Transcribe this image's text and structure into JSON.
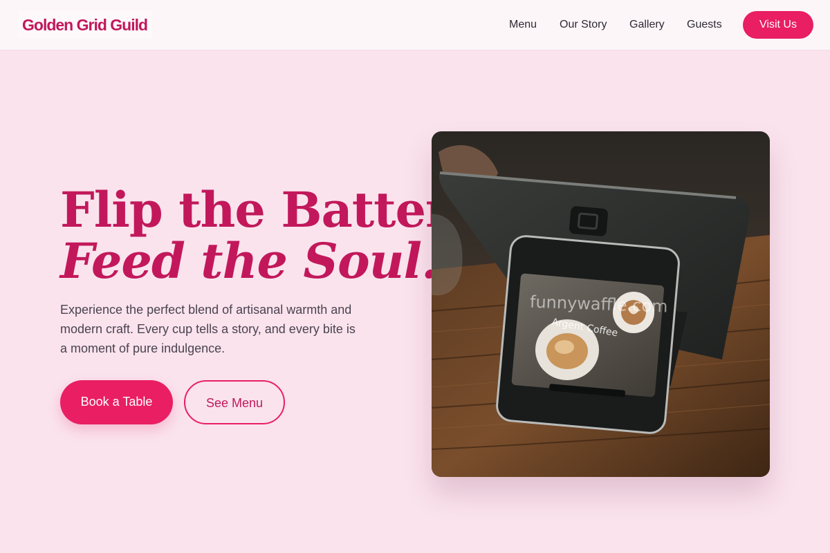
{
  "header": {
    "logo": "Golden Grid Guild",
    "nav": [
      "Menu",
      "Our Story",
      "Gallery",
      "Guests"
    ],
    "cta": "Visit Us"
  },
  "hero": {
    "headline_line1": "Flip the Batter,",
    "headline_line2": "Feed the Soul.",
    "lead": "Experience the perfect blend of artisanal warmth and modern craft. Every cup tells a story, and every bite is a moment of pure indulgence.",
    "primary_button": "Book a Table",
    "secondary_button": "See Menu"
  },
  "image": {
    "watermark": "funnywaffle.com",
    "screen_label": "Argent Coffee"
  },
  "colors": {
    "accent": "#e91e63",
    "headline": "#c2185b",
    "background": "#fae3ed",
    "header_bg": "#fdf6f9"
  }
}
